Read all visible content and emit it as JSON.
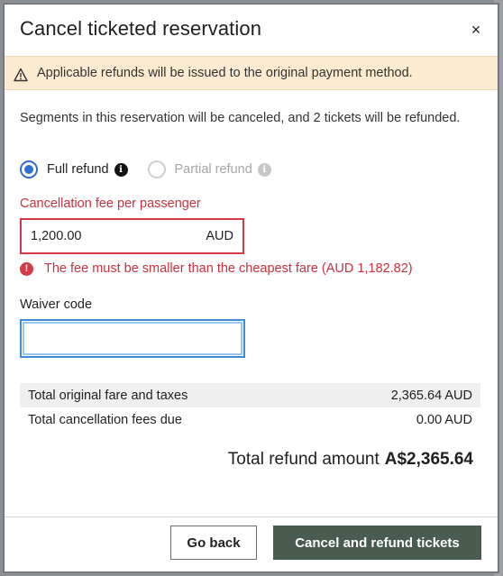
{
  "dialog": {
    "title": "Cancel ticketed reservation",
    "close_icon": "close-icon",
    "close_glyph": "×"
  },
  "banner": {
    "icon": "warning-icon",
    "text": "Applicable refunds will be issued to the original payment method."
  },
  "description": "Segments in this reservation will be canceled, and 2 tickets will be refunded.",
  "refund_type": {
    "options": [
      {
        "label": "Full refund",
        "selected": true,
        "disabled": false
      },
      {
        "label": "Partial refund",
        "selected": false,
        "disabled": true
      }
    ],
    "info_glyph": "i"
  },
  "cancellation_fee": {
    "label": "Cancellation fee per passenger",
    "value": "1,200.00",
    "currency": "AUD",
    "error_glyph": "!",
    "error": "The fee must be smaller than the cheapest fare (AUD 1,182.82)"
  },
  "waiver": {
    "label": "Waiver code",
    "value": ""
  },
  "summary": {
    "rows": [
      {
        "label": "Total original fare and taxes",
        "value": "2,365.64 AUD"
      },
      {
        "label": "Total cancellation fees due",
        "value": "0.00 AUD"
      }
    ],
    "total_label": "Total refund amount",
    "total_value": "A$2,365.64"
  },
  "footer": {
    "back_label": "Go back",
    "confirm_label": "Cancel and refund tickets"
  },
  "colors": {
    "accent": "#2f6fd1",
    "error": "#d23a45",
    "banner_bg": "#fcebd0",
    "primary_button": "#4a5b50"
  }
}
